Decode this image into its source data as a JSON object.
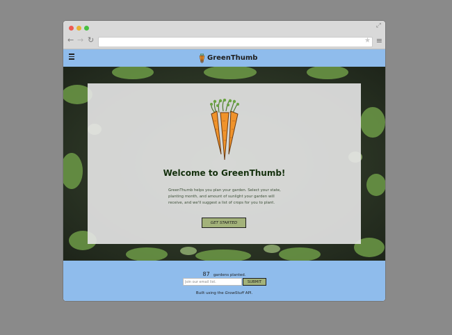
{
  "browser": {
    "url": ""
  },
  "header": {
    "brand": "GreenThumb"
  },
  "hero": {
    "heading": "Welcome to GreenThumb!",
    "intro": "GreenThumb helps you plan your garden. Select your state, planting month, and amount of sunlight your garden will receive, and we'll suggest a list of crops for you to plant.",
    "cta_label": "GET STARTED"
  },
  "footer": {
    "gardens_count": "87",
    "gardens_label": "gardens planted.",
    "email_placeholder": "Join our email list.",
    "submit_label": "SUBMIT",
    "credit_prefix": "Built using the ",
    "credit_link": "GrowStuff",
    "credit_suffix": " API."
  },
  "colors": {
    "header_bg": "#8fbcec",
    "button_bg": "#a3b27a",
    "heading": "#14300d",
    "carrot": "#f0932b"
  },
  "icons": [
    "menu-icon",
    "carrot-logo-icon",
    "back-arrow-icon",
    "forward-arrow-icon",
    "reload-icon",
    "star-icon",
    "expand-icon"
  ]
}
